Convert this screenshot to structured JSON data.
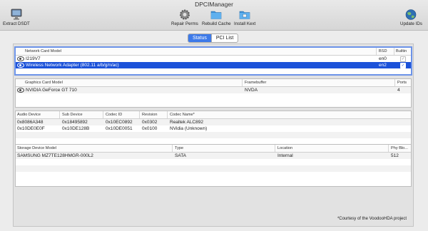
{
  "window": {
    "title": "DPCIManager"
  },
  "toolbar": {
    "extract_dsdt": "Extract DSDT",
    "repair_perms": "Repair Perms",
    "rebuild_cache": "Rebuild Cache",
    "install_kext": "Install Kext",
    "update_ids": "Update IDs"
  },
  "tabs": {
    "status": "Status",
    "pci_list": "PCI List",
    "selected": "Status"
  },
  "network": {
    "headers": {
      "model": "Network Card Model",
      "bsd": "BSD",
      "builtin": "Builtin"
    },
    "rows": [
      {
        "model": "I219V7",
        "bsd": "en0",
        "builtin": "✓"
      },
      {
        "model": "Wireless Network Adapter (802.11 a/b/g/n/ac)",
        "bsd": "en2",
        "builtin": "✓"
      }
    ]
  },
  "graphics": {
    "headers": {
      "model": "Graphics Card Model",
      "framebuffer": "Framebuffer",
      "ports": "Ports"
    },
    "rows": [
      {
        "model": "NVIDIA GeForce GT 710",
        "framebuffer": "NVDA",
        "ports": "4"
      }
    ]
  },
  "audio": {
    "headers": {
      "device": "Audio Device",
      "subdevice": "Sub Device",
      "codec_id": "Codec ID",
      "revision": "Revision",
      "codec_name": "Codec Name*"
    },
    "rows": [
      {
        "device": "0x8086A348",
        "subdevice": "0x18495892",
        "codec_id": "0x10EC0892",
        "revision": "0x0302",
        "codec_name": "Realtek ALC892"
      },
      {
        "device": "0x10DE0E0F",
        "subdevice": "0x10DE128B",
        "codec_id": "0x10DE0051",
        "revision": "0x0100",
        "codec_name": "NVidia (Unknown)"
      }
    ]
  },
  "storage": {
    "headers": {
      "model": "Storage Device Model",
      "type": "Type",
      "location": "Location",
      "block": "Phy Blo..."
    },
    "rows": [
      {
        "model": "SAMSUNG MZ7TE128HMGR-000L2",
        "type": "SATA",
        "location": "Internal",
        "block": "512"
      }
    ]
  },
  "footer": {
    "courtesy": "*Courtesy of the VoodooHDA project"
  },
  "colors": {
    "selection": "#1c52d9",
    "segment_active": "#3d7ae9",
    "focus_ring": "#6c93e8"
  }
}
